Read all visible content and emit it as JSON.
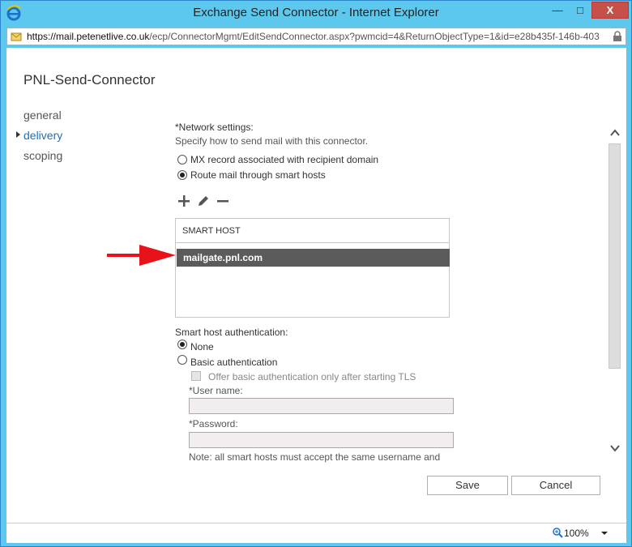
{
  "window": {
    "title": "Exchange Send Connector - Internet Explorer",
    "min_glyph": "—",
    "max_glyph": "□",
    "close_glyph": "X"
  },
  "address": {
    "url_prefix": "https://mail.",
    "url_domain": "petenetlive.co.uk",
    "url_rest": "/ecp/ConnectorMgmt/EditSendConnector.aspx?pwmcid=4&ReturnObjectType=1&id=e28b435f-146b-403"
  },
  "page": {
    "title": "PNL-Send-Connector",
    "nav": [
      {
        "label": "general"
      },
      {
        "label": "delivery"
      },
      {
        "label": "scoping"
      }
    ]
  },
  "network": {
    "heading": "*Network settings:",
    "description": "Specify how to send mail with this connector.",
    "option_mx": "MX record associated with recipient domain",
    "option_smart": "Route mail through smart hosts"
  },
  "smart_hosts": {
    "column_header": "SMART HOST",
    "rows": [
      "mailgate.pnl.com"
    ]
  },
  "auth": {
    "heading": "Smart host authentication:",
    "option_none": "None",
    "option_basic": "Basic authentication",
    "tls_checkbox": "Offer basic authentication only after starting TLS",
    "username_label": "*User name:",
    "password_label": "*Password:",
    "note": "Note: all smart hosts must accept the same username and"
  },
  "buttons": {
    "save": "Save",
    "cancel": "Cancel"
  },
  "statusbar": {
    "zoom": "100%"
  },
  "colors": {
    "titlebar": "#5cc8ee",
    "close_button": "#c7504a",
    "selected_row": "#5b5b5b",
    "active_nav": "#1e6fb5",
    "annotation_arrow": "#e8131a"
  }
}
